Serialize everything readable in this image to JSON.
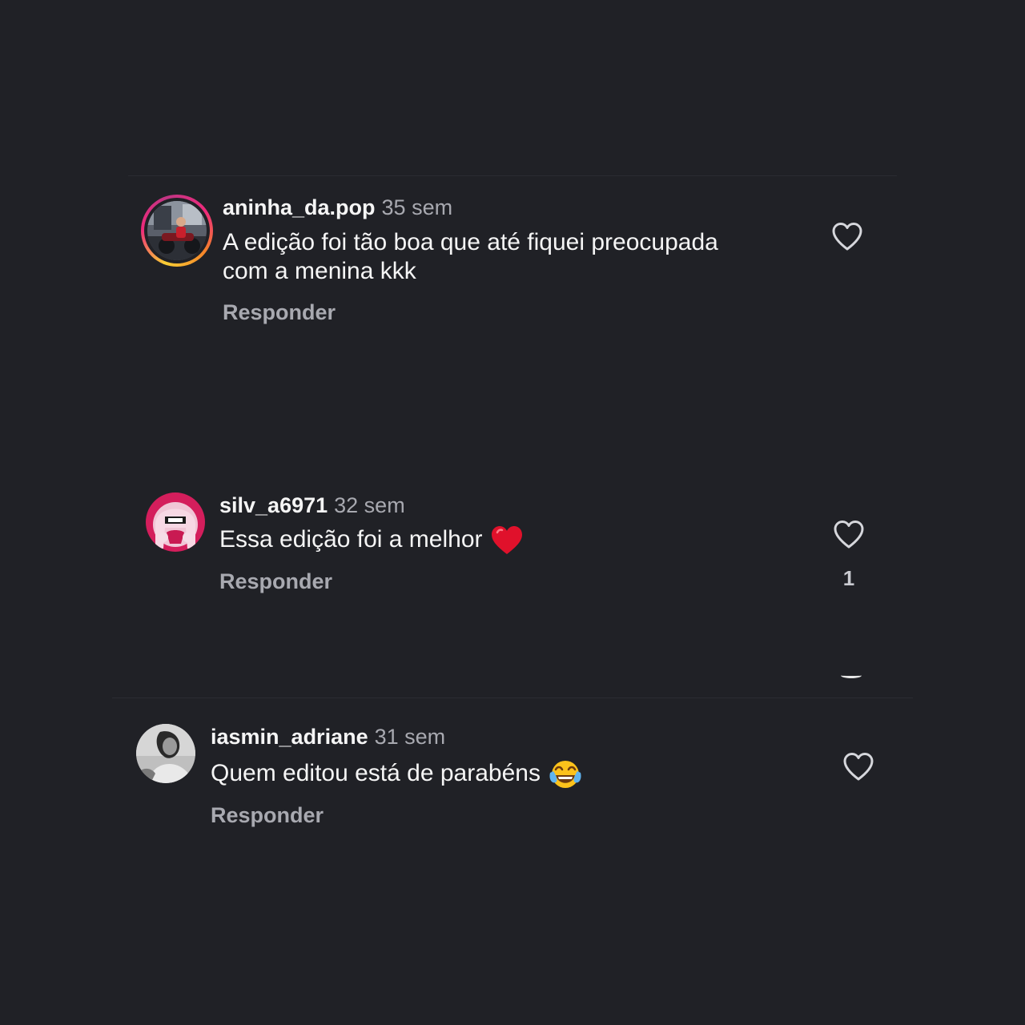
{
  "comments": [
    {
      "username": "aninha_da.pop",
      "time": "35 sem",
      "text_lines": [
        "A edição foi tão boa que até fiquei preocupada",
        "com a menina kkk"
      ],
      "reply_label": "Responder",
      "like_count": "",
      "has_story_ring": true,
      "like_icon": "heart-outline-icon"
    },
    {
      "username": "silv_a6971",
      "time": "32 sem",
      "text": "Essa edição foi a melhor",
      "emoji": "red-heart-emoji",
      "reply_label": "Responder",
      "like_count": "1",
      "has_story_ring": false,
      "like_icon": "heart-outline-icon"
    },
    {
      "username": "iasmin_adriane",
      "time": "31 sem",
      "text": "Quem editou está de parabéns",
      "emoji": "tears-of-joy-emoji",
      "reply_label": "Responder",
      "like_count": "",
      "has_story_ring": false,
      "like_icon": "heart-outline-icon"
    }
  ],
  "colors": {
    "background": "#202126",
    "text_primary": "#f5f5f5",
    "text_secondary": "#a8a9b0",
    "divider": "#2b2c32",
    "heart_emoji": "#e0112b"
  }
}
